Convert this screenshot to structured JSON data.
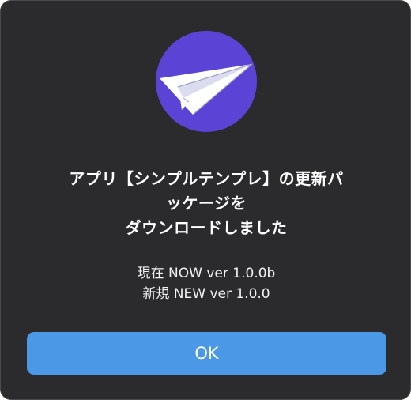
{
  "dialog": {
    "icon": "paper-plane-icon",
    "accent_color": "#5b43d6",
    "message_lines": [
      "アプリ【シンプルテンプレ】の更新パ",
      "ッケージを",
      "ダウンロードしました"
    ],
    "current_version": "現在 NOW ver 1.0.0b",
    "new_version": "新規 NEW ver 1.0.0",
    "ok_label": "OK",
    "button_color": "#4a98e6"
  }
}
